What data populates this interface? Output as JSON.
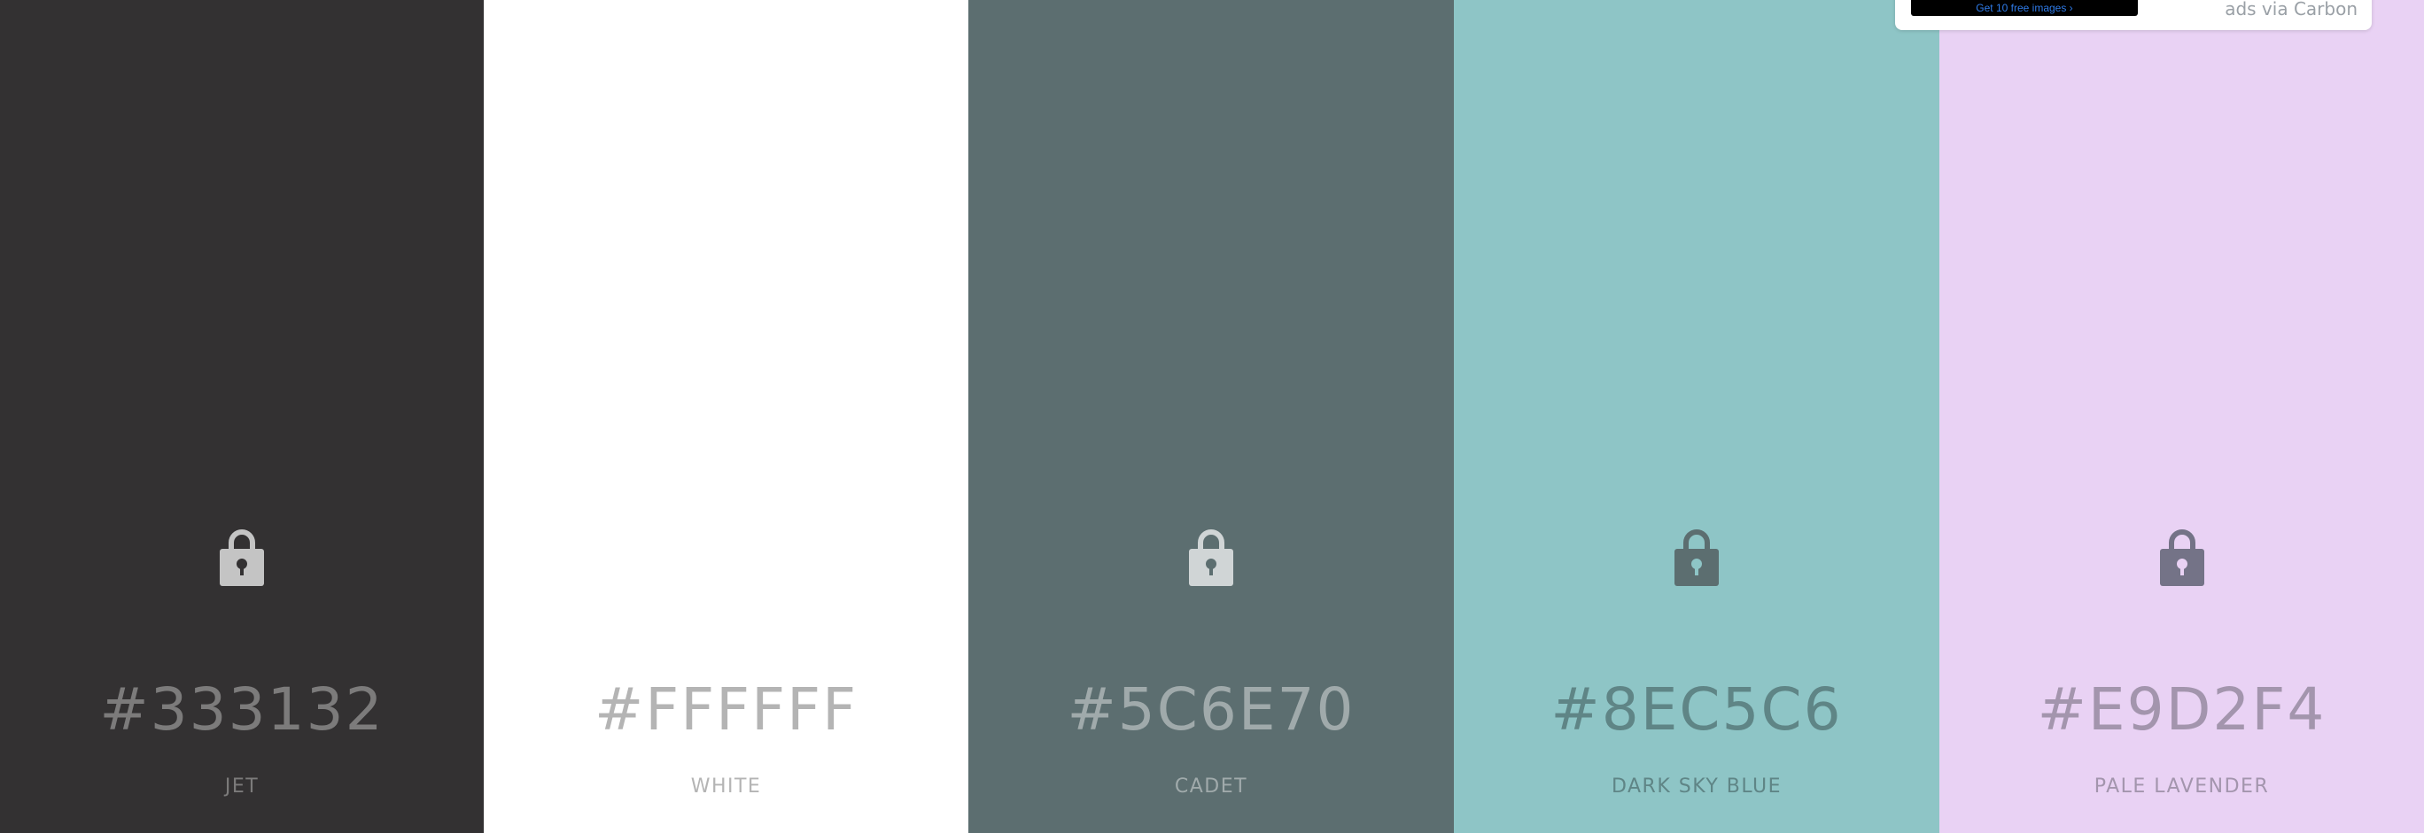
{
  "palette": {
    "colors": [
      {
        "hex": "#333132",
        "name": "JET",
        "background": "#333132",
        "text_color": "#7c7b7b",
        "icon_color": "#c4c4c4",
        "icon": "lock-icon"
      },
      {
        "hex": "#FFFFFF",
        "name": "WHITE",
        "background": "#FFFFFF",
        "text_color": "#b4b4b4",
        "icon_color": "#ffffff",
        "icon": "lock-icon"
      },
      {
        "hex": "#5C6E70",
        "name": "CADET",
        "background": "#5C6E70",
        "text_color": "#a0aaab",
        "icon_color": "#d0d5d6",
        "icon": "lock-icon"
      },
      {
        "hex": "#8EC5C6",
        "name": "DARK SKY BLUE",
        "background": "#8EC5C6",
        "text_color": "#5f8586",
        "icon_color": "#5c6e70",
        "icon": "lock-icon"
      },
      {
        "hex": "#E9D2F4",
        "name": "PALE LAVENDER",
        "background": "#E9D2F4",
        "text_color": "#a395ad",
        "icon_color": "#747387",
        "icon": "lock-icon"
      }
    ]
  },
  "ad": {
    "image_text": "Get 10 free images ›",
    "via_text": "ads via Carbon",
    "image_background": "#000000"
  }
}
